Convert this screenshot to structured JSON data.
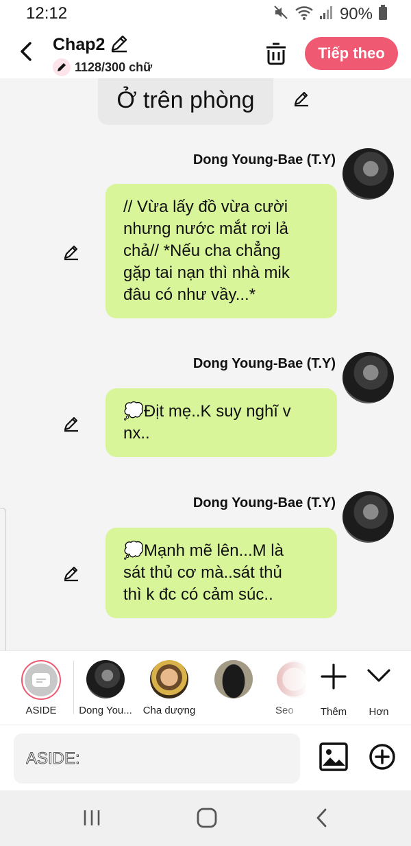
{
  "status_bar": {
    "time": "12:12",
    "battery_text": "90%",
    "icons": [
      "mute-icon",
      "wifi-icon",
      "signal-icon",
      "battery-icon"
    ]
  },
  "header": {
    "title": "Chap2",
    "char_count": "1128/300 chữ",
    "next_label": "Tiếp theo",
    "accent_color": "#ef5a72"
  },
  "chat": {
    "location": "Ở trên phòng",
    "messages": [
      {
        "sender": "Dong Young-Bae (T.Y)",
        "lines": [
          "// Vừa lấy đồ vừa cười",
          "nhưng nước mắt rơi lả",
          "chả// *Nếu cha chẳng",
          "gặp tai nạn thì nhà mik",
          "đâu có như vầy...*"
        ]
      },
      {
        "sender": "Dong Young-Bae (T.Y)",
        "lines": [
          "💭Địt mẹ..K suy nghĩ v",
          "nx.."
        ]
      },
      {
        "sender": "Dong Young-Bae (T.Y)",
        "lines": [
          "💭Mạnh mẽ lên...M là",
          "sát thủ cơ mà..sát thủ",
          "thì k đc có cảm súc.."
        ]
      }
    ],
    "bubble_color": "#d8f59a"
  },
  "characters": {
    "items": [
      {
        "label": "ASIDE"
      },
      {
        "label": "Dong You..."
      },
      {
        "label": "Cha dượng"
      },
      {
        "label": ""
      },
      {
        "label": "Seo"
      }
    ],
    "more_label": "Thêm",
    "expand_label": "Hơn"
  },
  "input": {
    "placeholder": "ASIDE:"
  }
}
